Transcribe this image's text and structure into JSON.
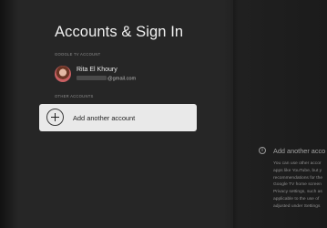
{
  "page": {
    "title": "Accounts & Sign In"
  },
  "sections": {
    "google_tv_account_label": "GOOGLE TV ACCOUNT",
    "other_accounts_label": "OTHER ACCOUNTS"
  },
  "account": {
    "name": "Rita El Khoury",
    "email_suffix": "@gmail.com",
    "email_prefix_redacted": true
  },
  "add_account": {
    "label": "Add another account",
    "icon": "plus-circle-icon"
  },
  "info_panel": {
    "icon": "info-icon",
    "title": "Add another acco",
    "body_lines": [
      "You can use other accor",
      "apps like YouTube, but y",
      "recommendations for the",
      "Google TV home screen",
      "Privacy settings, such as",
      "applicable to the use of",
      "adjusted under Settings"
    ]
  },
  "colors": {
    "background": "#262626",
    "card": "#e9e9e9",
    "text_primary": "#f1f1f1",
    "text_secondary": "#8e8e8e"
  }
}
